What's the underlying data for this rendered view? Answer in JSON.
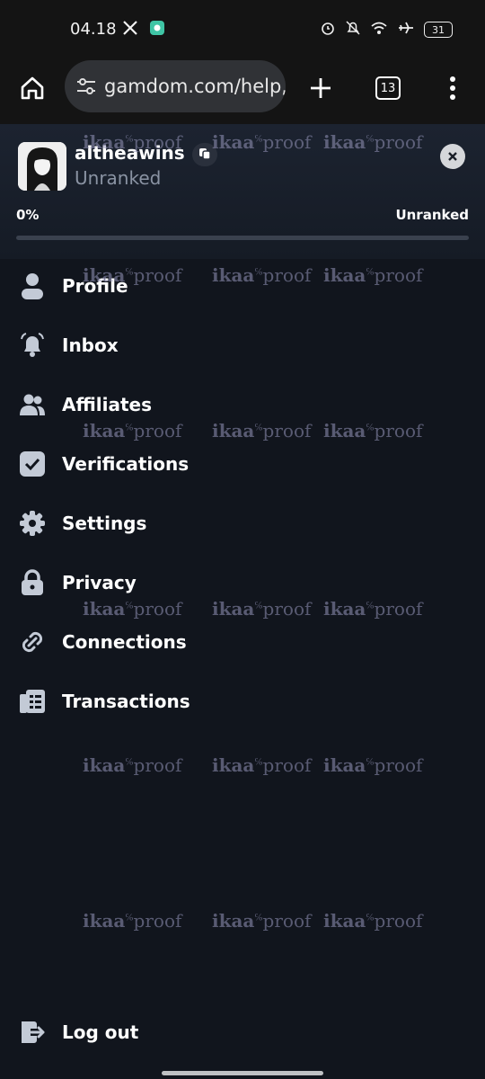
{
  "status_bar": {
    "time": "04.18",
    "battery": "31",
    "icons": [
      "x-logo-icon",
      "app-notification-icon",
      "alarm-icon",
      "bell-off-icon",
      "wifi-icon",
      "airplane-icon",
      "battery-icon"
    ]
  },
  "browser": {
    "url": "gamdom.com/help,",
    "tab_count": "13",
    "icons": [
      "home-icon",
      "site-settings-icon",
      "new-tab-icon",
      "tabs-icon",
      "more-menu-icon"
    ]
  },
  "user": {
    "username": "altheawins",
    "rank": "Unranked",
    "progress_label": "0%",
    "progress_value": 0,
    "next_rank": "Unranked"
  },
  "menu": {
    "items": [
      {
        "label": "Profile",
        "icon": "user-icon"
      },
      {
        "label": "Inbox",
        "icon": "bell-icon"
      },
      {
        "label": "Affiliates",
        "icon": "users-icon"
      },
      {
        "label": "Verifications",
        "icon": "check-square-icon"
      },
      {
        "label": "Settings",
        "icon": "gear-icon"
      },
      {
        "label": "Privacy",
        "icon": "lock-icon"
      },
      {
        "label": "Connections",
        "icon": "link-icon"
      },
      {
        "label": "Transactions",
        "icon": "receipt-icon"
      }
    ],
    "logout": {
      "label": "Log out",
      "icon": "logout-icon"
    }
  },
  "watermark": {
    "brand": "ikaa",
    "suffix": "proof",
    "mark": "℅"
  },
  "colors": {
    "background": "#11151d",
    "accent": "#8fd14f",
    "muted_text": "#8a93a3"
  }
}
